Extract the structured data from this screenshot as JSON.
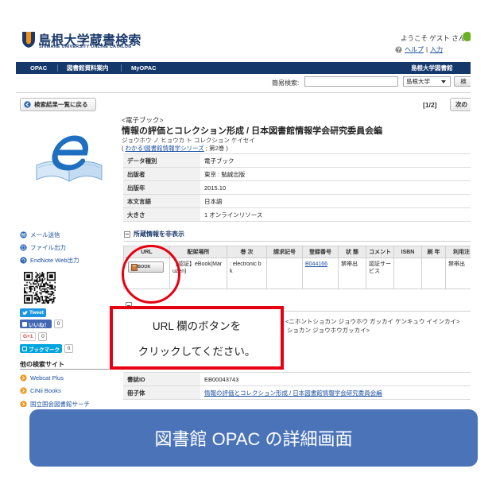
{
  "header": {
    "logo_title": "島根大学蔵書検索",
    "logo_subtitle": "SHIMANE UNIVERSITY ONLINE CATALOG",
    "welcome": "ようこそ ゲスト さん",
    "help_label": "ヘルプ",
    "separator": "|",
    "input_label": "入力"
  },
  "nav": {
    "items": [
      "OPAC",
      "図書館資料案内",
      "MyOPAC"
    ],
    "library": "島根大学図書館"
  },
  "search": {
    "label": "簡易検索:",
    "value": "",
    "scope": "島根大学",
    "button": "検"
  },
  "back_button": "検索結果一覧に戻る",
  "pager": {
    "position": "[1/2]",
    "next": "次の"
  },
  "record": {
    "material_type": "<電子ブック>",
    "title": "情報の評価とコレクション形成 / 日本図書館情報学会研究委員会編",
    "reading": "ジョウホウ ノ ヒョウカ ト コレクション ケイセイ",
    "series_prefix": "(",
    "series_name": "わかる!図書館情報学シリーズ",
    "series_volume": "; 第2巻",
    "series_suffix": ")"
  },
  "bib_table": [
    {
      "label": "データ種別",
      "value": "電子ブック"
    },
    {
      "label": "出版者",
      "value": "東京 : 勉誠出版"
    },
    {
      "label": "出版年",
      "value": "2015.10"
    },
    {
      "label": "本文言語",
      "value": "日本語"
    },
    {
      "label": "大きさ",
      "value": "1 オンラインリソース"
    }
  ],
  "holdings": {
    "toggle": "所蔵情報を非表示",
    "headers": [
      "URL",
      "配架場所",
      "巻 次",
      "請求記号",
      "登録番号",
      "状 態",
      "コメント",
      "ISBN",
      "刷 年",
      "利用注"
    ],
    "rows": [
      {
        "url_button": "BOOK",
        "location": "【認証】eBook(Maruzen)",
        "volume": ": electronic bk",
        "call_number": "",
        "reg_number": "B044166",
        "status": "禁帯出",
        "comment": "認証サービス",
        "isbn": "",
        "year": "",
        "note": "禁帯出"
      }
    ]
  },
  "sidebar": {
    "actions": [
      {
        "label": "メール送信",
        "icon": "mail-icon"
      },
      {
        "label": "ファイル出力",
        "icon": "file-export-icon"
      },
      {
        "label": "EndNote Web出力",
        "icon": "endnote-icon"
      }
    ],
    "social": {
      "tweet": "Tweet",
      "like": "いいね！",
      "like_count": "0",
      "gplus": "G+1",
      "gplus_count": "0",
      "bookmark": "ブックマーク",
      "bookmark_count": "0"
    },
    "other_sites_heading": "他の検索サイト",
    "other_sites": [
      "Webcat Plus",
      "CiNii Books",
      "国立国会図書館サーチ"
    ]
  },
  "authors_partial": [
    "<ニホントショカン ジョウホウ ガッカイ ケンキュウ イインカイ>",
    "ショカン ジョウホウガッカイ>"
  ],
  "bib_bottom": [
    {
      "label": "書誌ID",
      "value": "EB00043743"
    },
    {
      "label": "冊子体",
      "value": "情報の評価とコレクション形成 / 日本図書館情報学会研究委員会編"
    }
  ],
  "callout": {
    "line1": "URL 欄のボタンを",
    "line2": "クリックしてください。"
  },
  "banner": "図書館 OPAC の詳細画面",
  "colors": {
    "nav_bar": "#15386b",
    "annotation_red": "#e60012",
    "banner_blue": "#4b74b8",
    "link_blue": "#1a4fa0"
  }
}
